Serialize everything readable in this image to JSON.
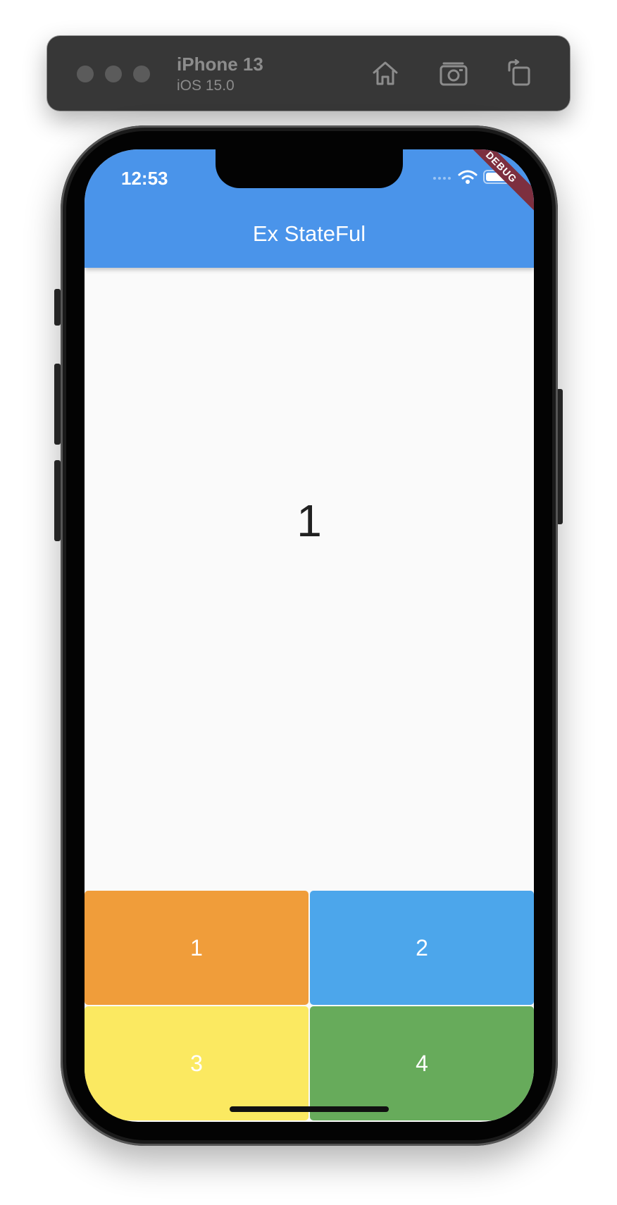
{
  "simulator": {
    "device_name": "iPhone 13",
    "os_version": "iOS 15.0",
    "toolbar_icons": [
      "home-icon",
      "screenshot-icon",
      "rotate-icon"
    ]
  },
  "status_bar": {
    "time": "12:53",
    "icons": [
      "signal-icon",
      "wifi-icon",
      "battery-icon"
    ]
  },
  "app": {
    "title": "Ex StateFul",
    "debug_banner": "DEBUG",
    "counter_value": "1",
    "buttons": [
      {
        "label": "1",
        "color": "#f09d3a"
      },
      {
        "label": "2",
        "color": "#4ca6eb"
      },
      {
        "label": "3",
        "color": "#fbe961"
      },
      {
        "label": "4",
        "color": "#67ab5b"
      }
    ]
  },
  "colors": {
    "app_bar": "#4a94ea",
    "background": "#fafafa",
    "debug_ribbon": "#7d2f3f"
  }
}
